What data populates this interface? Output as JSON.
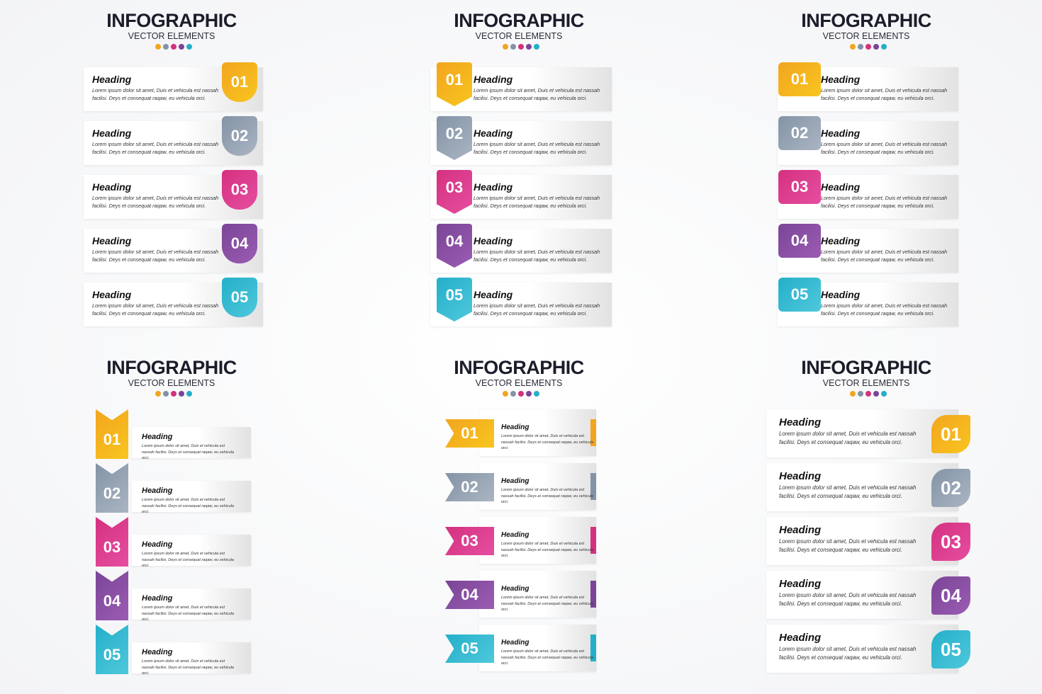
{
  "colors": [
    "#f2a51f",
    "#8393a6",
    "#d4317f",
    "#7a4596",
    "#24afc9"
  ],
  "colors_light": [
    "#f8c51f",
    "#aab5c2",
    "#e64ea0",
    "#9b5cb3",
    "#4fc8dc"
  ],
  "panels": [
    {
      "title": "INFOGRAPHIC",
      "subtitle": "VECTOR ELEMENTS",
      "items": [
        {
          "number": "01",
          "heading": "Heading",
          "text": "Lorem ipsum dolor sit amet, Duis et vehicula est nassah facilisi. Deys et consequat raqaw, eu vehicula orci."
        },
        {
          "number": "02",
          "heading": "Heading",
          "text": "Lorem ipsum dolor sit amet, Duis et vehicula est nassah facilisi. Deys et consequat raqaw, eu vehicula orci."
        },
        {
          "number": "03",
          "heading": "Heading",
          "text": "Lorem ipsum dolor sit amet, Duis et vehicula est nassah facilisi. Deys et consequat raqaw, eu vehicula orci."
        },
        {
          "number": "04",
          "heading": "Heading",
          "text": "Lorem ipsum dolor sit amet, Duis et vehicula est nassah facilisi. Deys et consequat raqaw, eu vehicula orci."
        },
        {
          "number": "05",
          "heading": "Heading",
          "text": "Lorem ipsum dolor sit amet, Duis et vehicula est nassah facilisi. Deys et consequat raqaw, eu vehicula orci."
        }
      ]
    },
    {
      "title": "INFOGRAPHIC",
      "subtitle": "VECTOR ELEMENTS",
      "items": [
        {
          "number": "01",
          "heading": "Heading",
          "text": "Lorem ipsum dolor sit amet, Duis et vehicula est nassah facilisi. Deys et consequat raqaw, eu vehicula orci."
        },
        {
          "number": "02",
          "heading": "Heading",
          "text": "Lorem ipsum dolor sit amet, Duis et vehicula est nassah facilisi. Deys et consequat raqaw, eu vehicula orci."
        },
        {
          "number": "03",
          "heading": "Heading",
          "text": "Lorem ipsum dolor sit amet, Duis et vehicula est nassah facilisi. Deys et consequat raqaw, eu vehicula orci."
        },
        {
          "number": "04",
          "heading": "Heading",
          "text": "Lorem ipsum dolor sit amet, Duis et vehicula est nassah facilisi. Deys et consequat raqaw, eu vehicula orci."
        },
        {
          "number": "05",
          "heading": "Heading",
          "text": "Lorem ipsum dolor sit amet, Duis et vehicula est nassah facilisi. Deys et consequat raqaw, eu vehicula orci."
        }
      ]
    },
    {
      "title": "INFOGRAPHIC",
      "subtitle": "VECTOR ELEMENTS",
      "items": [
        {
          "number": "01",
          "heading": "Heading",
          "text": "Lorem ipsum dolor sit amet, Duis et vehicula est nassah facilisi. Deys et consequat raqaw, eu vehicula orci."
        },
        {
          "number": "02",
          "heading": "Heading",
          "text": "Lorem ipsum dolor sit amet, Duis et vehicula est nassah facilisi. Deys et consequat raqaw, eu vehicula orci."
        },
        {
          "number": "03",
          "heading": "Heading",
          "text": "Lorem ipsum dolor sit amet, Duis et vehicula est nassah facilisi. Deys et consequat raqaw, eu vehicula orci."
        },
        {
          "number": "04",
          "heading": "Heading",
          "text": "Lorem ipsum dolor sit amet, Duis et vehicula est nassah facilisi. Deys et consequat raqaw, eu vehicula orci."
        },
        {
          "number": "05",
          "heading": "Heading",
          "text": "Lorem ipsum dolor sit amet, Duis et vehicula est nassah facilisi. Deys et consequat raqaw, eu vehicula orci."
        }
      ]
    },
    {
      "title": "INFOGRAPHIC",
      "subtitle": "VECTOR ELEMENTS",
      "items": [
        {
          "number": "01",
          "heading": "Heading",
          "text": "Lorem ipsum dolor sit amet, Duis et vehicula est nassah facilisi. Deys et consequat raqaw, eu vehicula orci."
        },
        {
          "number": "02",
          "heading": "Heading",
          "text": "Lorem ipsum dolor sit amet, Duis et vehicula est nassah facilisi. Deys et consequat raqaw, eu vehicula orci."
        },
        {
          "number": "03",
          "heading": "Heading",
          "text": "Lorem ipsum dolor sit amet, Duis et vehicula est nassah facilisi. Deys et consequat raqaw, eu vehicula orci."
        },
        {
          "number": "04",
          "heading": "Heading",
          "text": "Lorem ipsum dolor sit amet, Duis et vehicula est nassah facilisi. Deys et consequat raqaw, eu vehicula orci."
        },
        {
          "number": "05",
          "heading": "Heading",
          "text": "Lorem ipsum dolor sit amet, Duis et vehicula est nassah facilisi. Deys et consequat raqaw, eu vehicula orci."
        }
      ]
    },
    {
      "title": "INFOGRAPHIC",
      "subtitle": "VECTOR ELEMENTS",
      "items": [
        {
          "number": "01",
          "heading": "Heading",
          "text": "Lorem ipsum dolor sit amet, Duis et vehicula est nassah facilisi. Deys et consequat raqaw, eu vehicula orci."
        },
        {
          "number": "02",
          "heading": "Heading",
          "text": "Lorem ipsum dolor sit amet, Duis et vehicula est nassah facilisi. Deys et consequat raqaw, eu vehicula orci."
        },
        {
          "number": "03",
          "heading": "Heading",
          "text": "Lorem ipsum dolor sit amet, Duis et vehicula est nassah facilisi. Deys et consequat raqaw, eu vehicula orci."
        },
        {
          "number": "04",
          "heading": "Heading",
          "text": "Lorem ipsum dolor sit amet, Duis et vehicula est nassah facilisi. Deys et consequat raqaw, eu vehicula orci."
        },
        {
          "number": "05",
          "heading": "Heading",
          "text": "Lorem ipsum dolor sit amet, Duis et vehicula est nassah facilisi. Deys et consequat raqaw, eu vehicula orci."
        }
      ]
    },
    {
      "title": "INFOGRAPHIC",
      "subtitle": "VECTOR ELEMENTS",
      "items": [
        {
          "number": "01",
          "heading": "Heading",
          "text": "Lorem ipsum dolor sit amet, Duis et vehicula est nassah facilisi. Deys et consequat raqaw, eu vehicula orci."
        },
        {
          "number": "02",
          "heading": "Heading",
          "text": "Lorem ipsum dolor sit amet, Duis et vehicula est nassah facilisi. Deys et consequat raqaw, eu vehicula orci."
        },
        {
          "number": "03",
          "heading": "Heading",
          "text": "Lorem ipsum dolor sit amet, Duis et vehicula est nassah facilisi. Deys et consequat raqaw, eu vehicula orci."
        },
        {
          "number": "04",
          "heading": "Heading",
          "text": "Lorem ipsum dolor sit amet, Duis et vehicula est nassah facilisi. Deys et consequat raqaw, eu vehicula orci."
        },
        {
          "number": "05",
          "heading": "Heading",
          "text": "Lorem ipsum dolor sit amet, Duis et vehicula est nassah facilisi. Deys et consequat raqaw, eu vehicula orci."
        }
      ]
    }
  ]
}
